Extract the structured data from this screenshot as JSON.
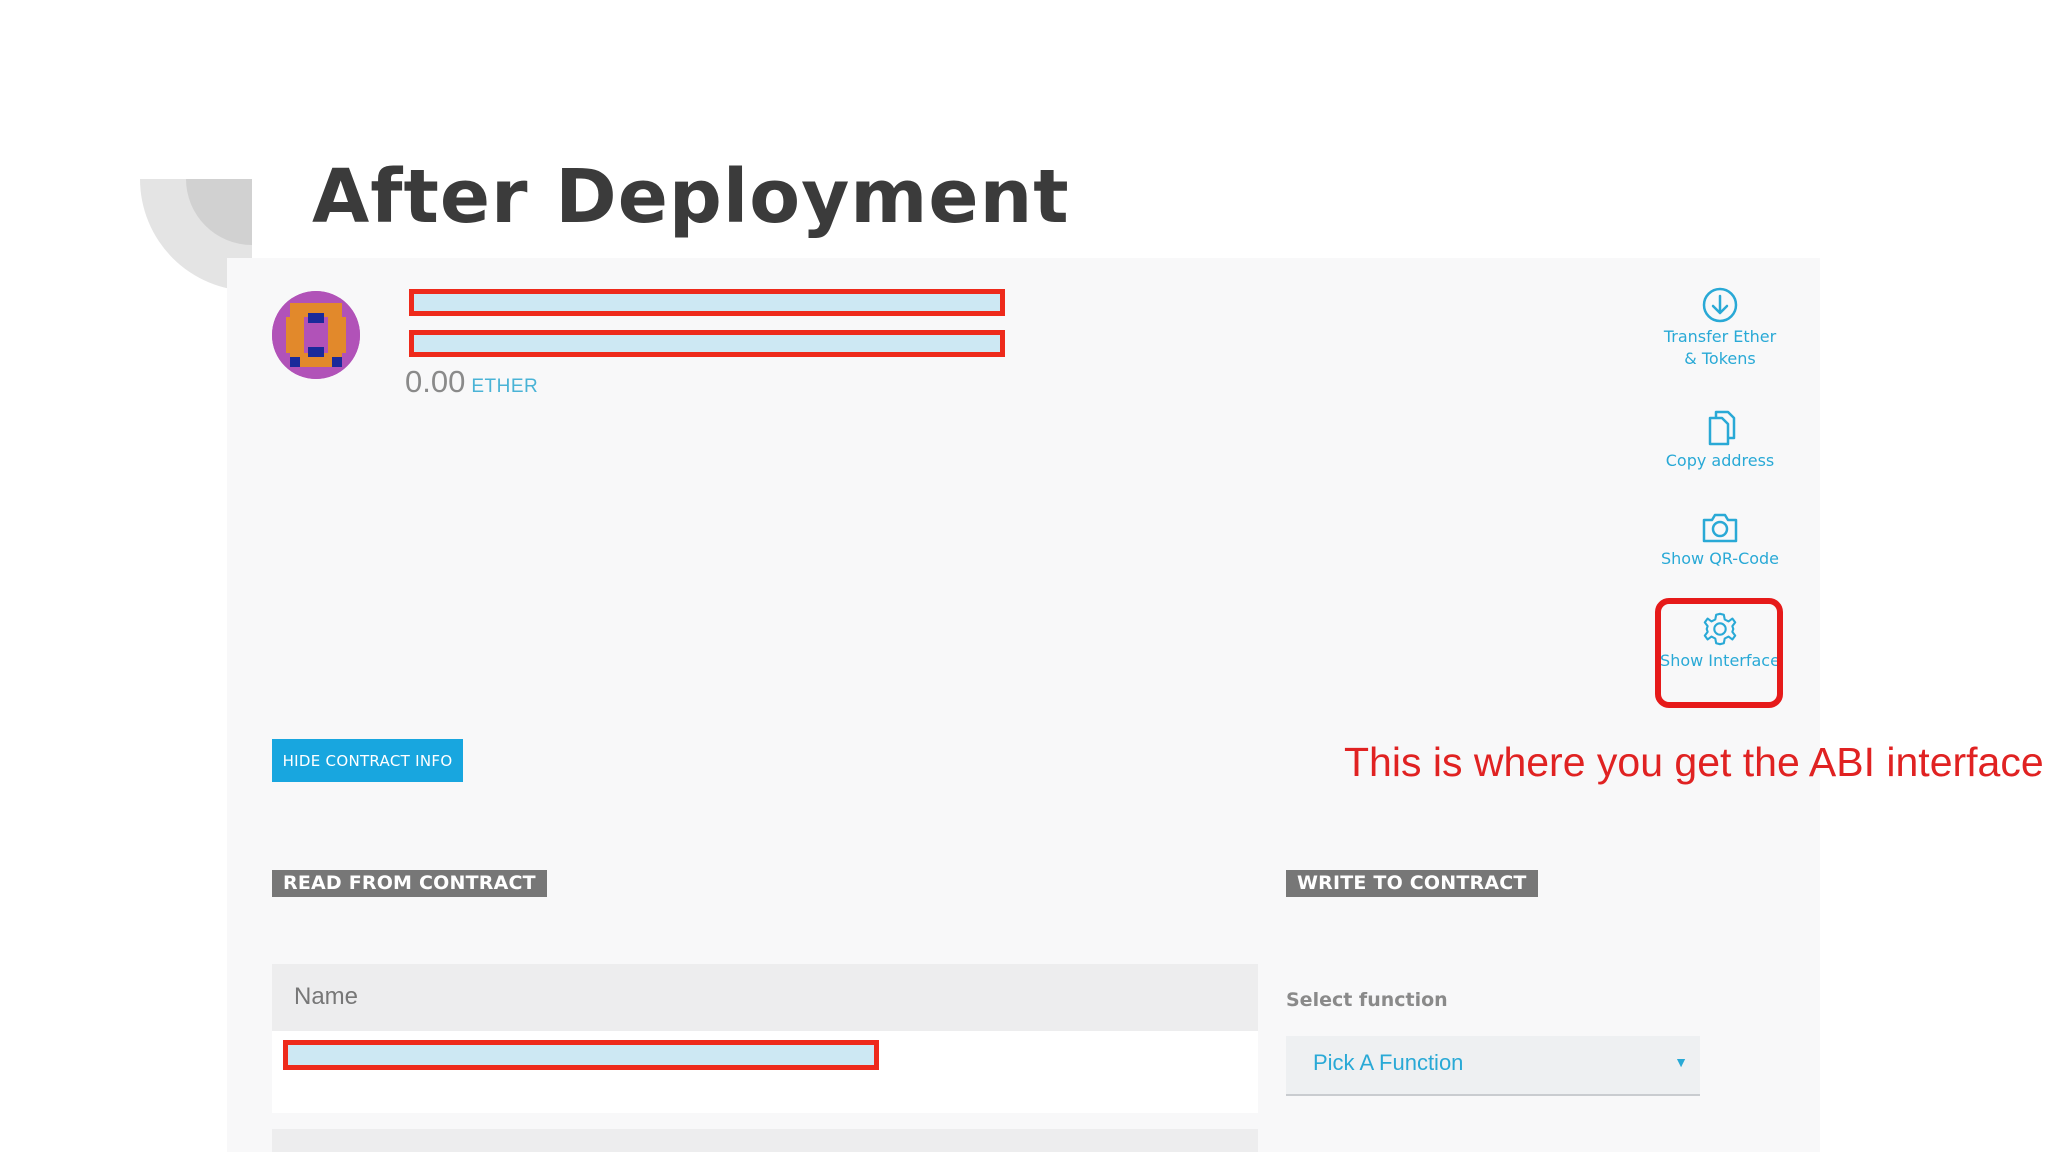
{
  "slide": {
    "title": "After Deployment"
  },
  "contract": {
    "balance": "0.00",
    "unit": "ETHER",
    "hide_button": "HIDE CONTRACT INFO"
  },
  "actions": [
    {
      "icon": "arrow-down-circle-icon",
      "label": "Transfer Ether & Tokens"
    },
    {
      "icon": "copy-icon",
      "label": "Copy address"
    },
    {
      "icon": "camera-icon",
      "label": "Show QR-Code"
    },
    {
      "icon": "gear-icon",
      "label": "Show Interface"
    }
  ],
  "read": {
    "title": "READ FROM CONTRACT",
    "field_label": "Name"
  },
  "write": {
    "title": "WRITE TO CONTRACT",
    "select_label": "Select function",
    "select_value": "Pick A Function"
  },
  "annotation": "This is where you get the ABI interface",
  "colors": {
    "accent": "#29a9d6",
    "button": "#18a6df",
    "highlight": "#e61a1a",
    "redaction_border": "#ee2a1b"
  }
}
